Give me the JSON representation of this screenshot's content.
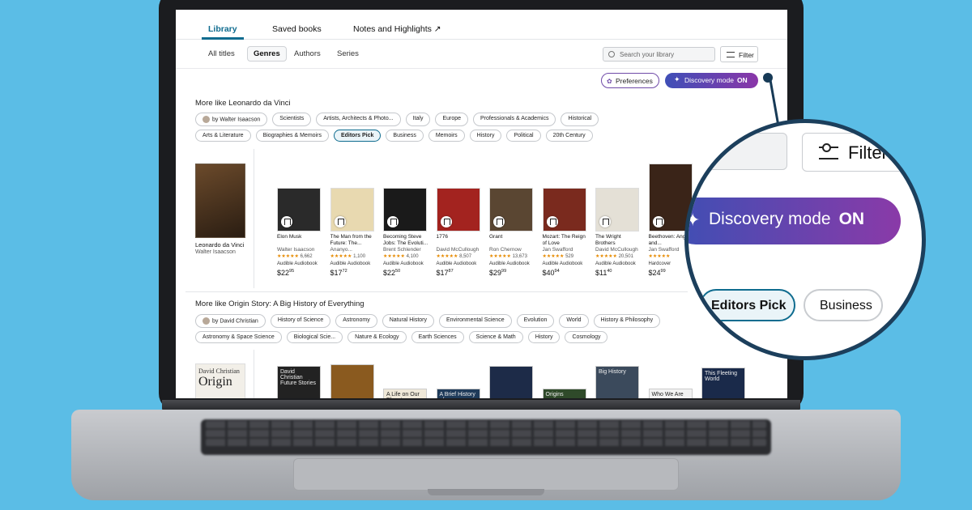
{
  "nav": {
    "tabs": [
      "Library",
      "Saved books",
      "Notes and Highlights ↗"
    ]
  },
  "subnav": {
    "tabs": [
      "All titles",
      "Genres",
      "Authors",
      "Series"
    ],
    "search_placeholder": "Search your library",
    "filter_label": "Filter"
  },
  "actions": {
    "preferences": "Preferences",
    "discovery": "Discovery mode",
    "discovery_state": "ON"
  },
  "section1": {
    "title": "More like Leonardo da Vinci",
    "chips": [
      "by Walter Isaacson",
      "Scientists",
      "Artists, Architects & Photo...",
      "Italy",
      "Europe",
      "Professionals & Academics",
      "Historical",
      "Arts & Literature",
      "Biographies & Memoirs",
      "Editors Pick",
      "Business",
      "Memoirs",
      "History",
      "Political",
      "20th Century"
    ],
    "seed": {
      "title": "Leonardo da Vinci",
      "author": "Walter Isaacson",
      "cover_color": "#6b4a2b"
    },
    "books": [
      {
        "title": "Elon Musk",
        "author": "Walter Isaacson",
        "stars": "★★★★★",
        "count": "6,662",
        "format": "Audible Audiobook",
        "price_whole": "$22",
        "price_frac": "95",
        "cover": "#2a2a2a"
      },
      {
        "title": "The Man from the Future: The...",
        "author": "Ananyo...",
        "stars": "★★★★★",
        "count": "1,100",
        "format": "Audible Audiobook",
        "price_whole": "$17",
        "price_frac": "72",
        "cover": "#e8d9b0"
      },
      {
        "title": "Becoming Steve Jobs: The Evoluti...",
        "author": "Brent Schlender",
        "stars": "★★★★★",
        "count": "4,100",
        "format": "Audible Audiobook",
        "price_whole": "$22",
        "price_frac": "50",
        "cover": "#1a1a1a"
      },
      {
        "title": "1776",
        "author": "David McCullough",
        "stars": "★★★★★",
        "count": "8,507",
        "format": "Audible Audiobook",
        "price_whole": "$17",
        "price_frac": "87",
        "cover": "#a3231f"
      },
      {
        "title": "Grant",
        "author": "Ron Chernow",
        "stars": "★★★★★",
        "count": "13,673",
        "format": "Audible Audiobook",
        "price_whole": "$29",
        "price_frac": "99",
        "cover": "#5a4632"
      },
      {
        "title": "Mozart: The Reign of Love",
        "author": "Jan Swafford",
        "stars": "★★★★★",
        "count": "529",
        "format": "Audible Audiobook",
        "price_whole": "$40",
        "price_frac": "94",
        "cover": "#7a2a1e"
      },
      {
        "title": "The Wright Brothers",
        "author": "David McCullough",
        "stars": "★★★★★",
        "count": "20,501",
        "format": "Audible Audiobook",
        "price_whole": "$11",
        "price_frac": "40",
        "cover": "#e4e0d6"
      },
      {
        "title": "Beethoven: Anguish and...",
        "author": "Jan Swafford",
        "stars": "★★★★★",
        "count": "",
        "format": "Hardcover",
        "price_whole": "$24",
        "price_frac": "99",
        "cover": "#3a2418"
      }
    ]
  },
  "section2": {
    "title": "More like Origin Story: A Big History of Everything",
    "chips": [
      "by David Christian",
      "History of Science",
      "Astronomy",
      "Natural History",
      "Environmental Science",
      "Evolution",
      "World",
      "History & Philosophy",
      "Astronomy & Space Science",
      "Biological Scie...",
      "Nature & Ecology",
      "Earth Sciences",
      "Science & Math",
      "History",
      "Cosmology"
    ],
    "seed": {
      "line1": "David Christian",
      "line2": "Origin"
    },
    "books": [
      {
        "cover": "#222222",
        "label": "David Christian Future Stories"
      },
      {
        "cover": "#8a5a1f",
        "label": ""
      },
      {
        "cover": "#efe8d8",
        "label": "A Life on Our Planet"
      },
      {
        "cover": "#1f3b5a",
        "label": "A Brief History of..."
      },
      {
        "cover": "#1d2b48",
        "label": ""
      },
      {
        "cover": "#2f4a2a",
        "label": "Origins"
      },
      {
        "cover": "#3b4a5c",
        "label": "Big History"
      },
      {
        "cover": "#f2f2f2",
        "label": "Who We Are"
      },
      {
        "cover": "#1a2a4a",
        "label": "This Fleeting World"
      }
    ]
  },
  "magnifier": {
    "filter_label": "Filter",
    "discovery": "Discovery mode",
    "discovery_state": "ON",
    "chip_selected": "Editors Pick",
    "chip_other": "Business"
  },
  "colors": {
    "background": "#5bbde6",
    "accent": "#0f6c8f",
    "discovery_start": "#3f4fb7",
    "discovery_end": "#8a36a8"
  }
}
